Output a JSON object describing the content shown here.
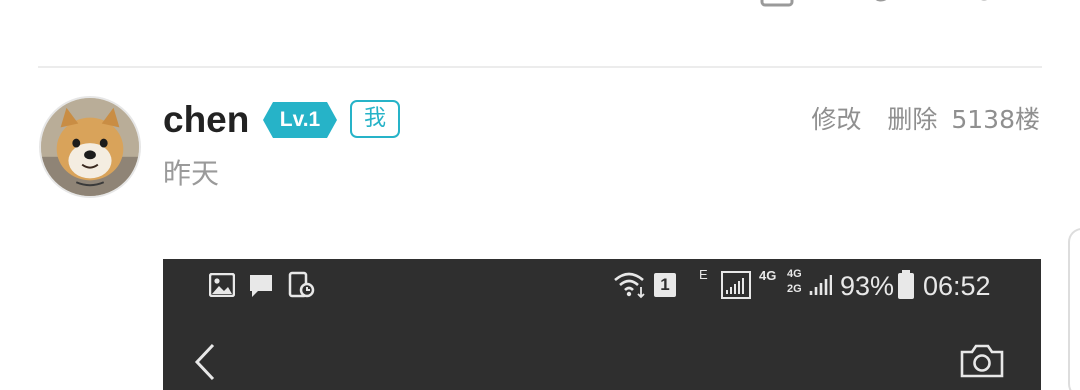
{
  "comment": {
    "username": "chen",
    "level_badge": "Lv.1",
    "me_badge": "我",
    "time": "昨天",
    "actions": {
      "edit": "修改",
      "delete": "删除",
      "floor": "5138楼"
    }
  },
  "embedded_screenshot": {
    "status_bar": {
      "network_e": "E",
      "net_4g": "4G",
      "net_4g_small": "4G",
      "net_2g_small": "2G",
      "sim_number": "1",
      "battery_percent": "93%",
      "clock": "06:52"
    }
  },
  "colors": {
    "accent": "#26b3c8",
    "muted_text": "#9a9a9a",
    "username": "#222222",
    "screenshot_bg": "#2f2f2f"
  },
  "icons": [
    "image-icon",
    "chat-icon",
    "screenshot-icon",
    "wifi-icon",
    "sim-icon",
    "signal-icon",
    "battery-icon",
    "back-chevron-icon",
    "camera-icon",
    "reply-icon",
    "share-icon",
    "list-icon"
  ]
}
